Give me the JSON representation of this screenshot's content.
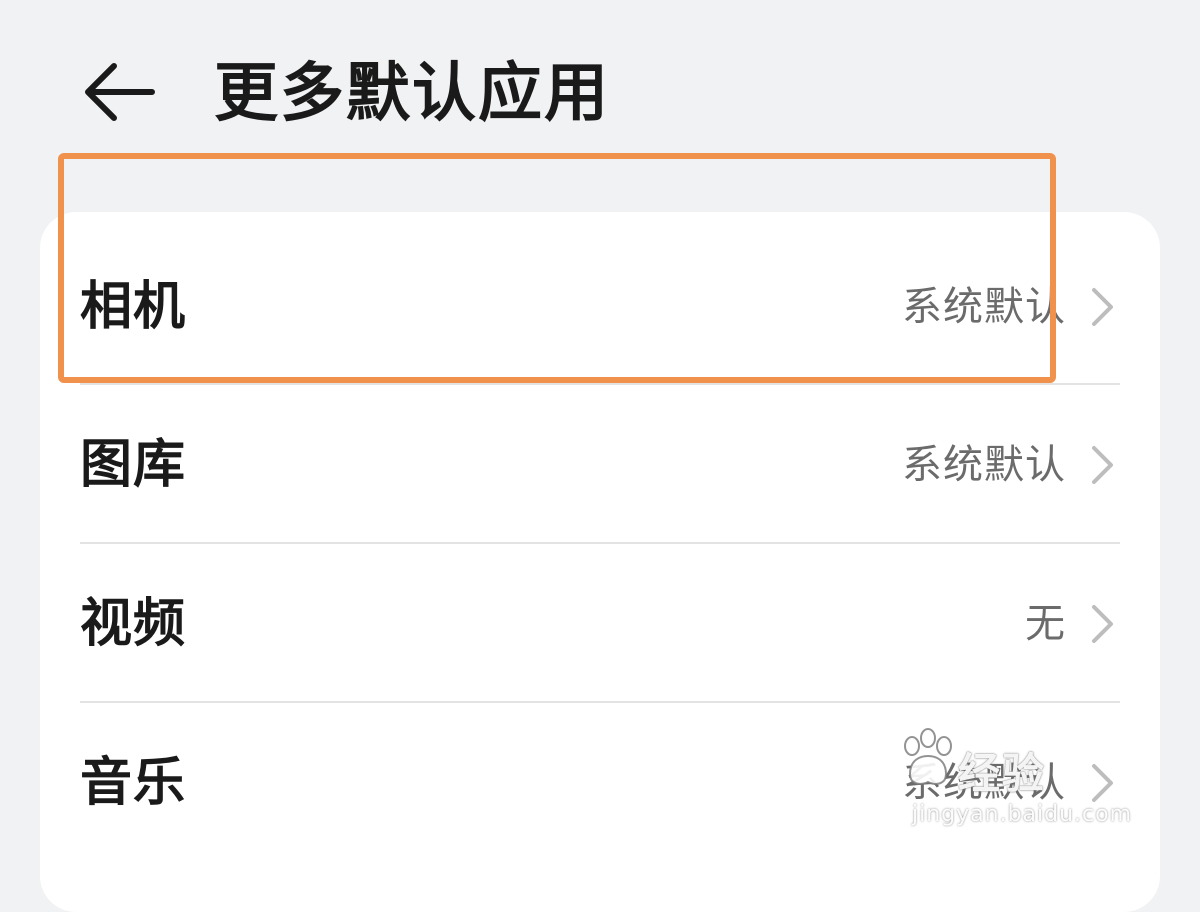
{
  "header": {
    "title": "更多默认应用",
    "back_icon": "arrow-left-icon"
  },
  "list": {
    "items": [
      {
        "label": "相机",
        "value": "系统默认"
      },
      {
        "label": "图库",
        "value": "系统默认"
      },
      {
        "label": "视频",
        "value": "无"
      },
      {
        "label": "音乐",
        "value": "系统默认"
      }
    ]
  },
  "annotation": {
    "highlight_color": "#f0914c",
    "highlighted_item": "相机"
  },
  "watermark": {
    "brand": "Baidu经验",
    "text": "经验",
    "url": "jingyan.baidu.com"
  },
  "colors": {
    "background": "#f1f2f4",
    "card": "#ffffff",
    "primary_text": "#1a1a1a",
    "secondary_text": "#6b6b6b",
    "chevron": "#bdbdbd",
    "divider": "#e3e3e3"
  }
}
